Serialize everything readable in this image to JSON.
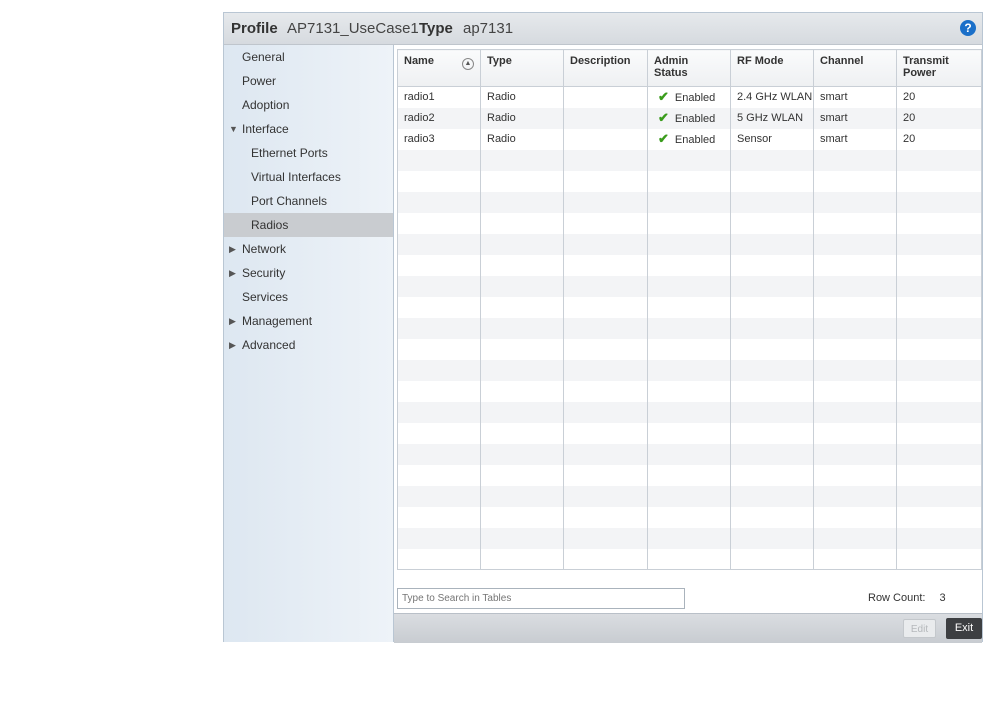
{
  "header": {
    "profile_label": "Profile",
    "profile_value": "AP7131_UseCase1",
    "type_label": "Type",
    "type_value": "ap7131",
    "help_icon": "?"
  },
  "sidebar": {
    "items": [
      {
        "label": "General",
        "arrow": ""
      },
      {
        "label": "Power",
        "arrow": ""
      },
      {
        "label": "Adoption",
        "arrow": ""
      },
      {
        "label": "Interface",
        "arrow": "▼"
      },
      {
        "label": "Ethernet Ports",
        "arrow": ""
      },
      {
        "label": "Virtual Interfaces",
        "arrow": ""
      },
      {
        "label": "Port Channels",
        "arrow": ""
      },
      {
        "label": "Radios",
        "arrow": ""
      },
      {
        "label": "Network",
        "arrow": "▶"
      },
      {
        "label": "Security",
        "arrow": "▶"
      },
      {
        "label": "Services",
        "arrow": ""
      },
      {
        "label": "Management",
        "arrow": "▶"
      },
      {
        "label": "Advanced",
        "arrow": "▶"
      }
    ],
    "selected": "Radios"
  },
  "table": {
    "columns": [
      "Name",
      "Type",
      "Description",
      "Admin Status",
      "RF Mode",
      "Channel",
      "Transmit Power"
    ],
    "rows": [
      {
        "name": "radio1",
        "type": "Radio",
        "description": "",
        "admin_status": "Enabled",
        "rf_mode": "2.4 GHz WLAN",
        "channel": "smart",
        "transmit_power": "20"
      },
      {
        "name": "radio2",
        "type": "Radio",
        "description": "",
        "admin_status": "Enabled",
        "rf_mode": "5 GHz WLAN",
        "channel": "smart",
        "transmit_power": "20"
      },
      {
        "name": "radio3",
        "type": "Radio",
        "description": "",
        "admin_status": "Enabled",
        "rf_mode": "Sensor",
        "channel": "smart",
        "transmit_power": "20"
      }
    ]
  },
  "search": {
    "placeholder": "Type to Search in Tables"
  },
  "row_count": {
    "label": "Row Count:",
    "value": "3"
  },
  "buttons": {
    "edit": "Edit",
    "exit": "Exit"
  },
  "colors": {
    "accent": "#1a6fc9",
    "check": "#3a9c1c",
    "exit_button": "#3d3f42"
  },
  "icons": {
    "sort": "sort-ascending-icon",
    "status": "checkmark-icon",
    "help": "help-icon"
  }
}
